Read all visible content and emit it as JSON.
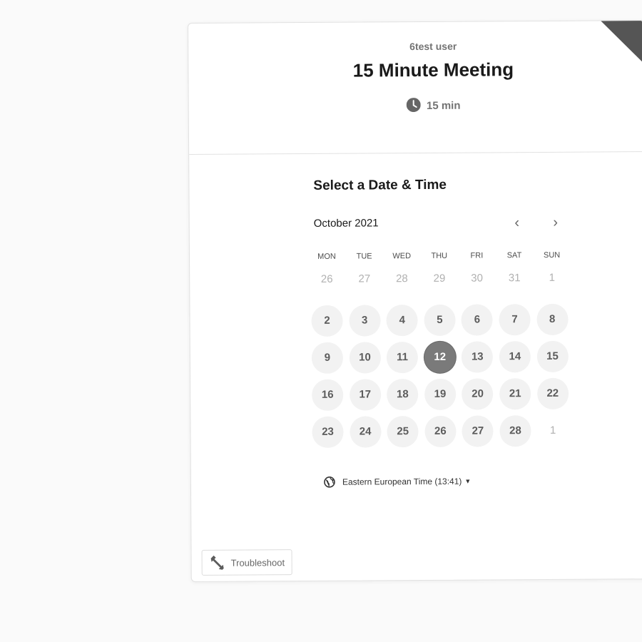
{
  "event": {
    "owner": "6test user",
    "title": "15 Minute Meeting",
    "duration": "15 min",
    "duration_icon": "clock-icon"
  },
  "calendar": {
    "heading": "Select a Date & Time",
    "month": "October 2021",
    "prev_label": "‹",
    "next_label": "›",
    "weekdays": [
      "MON",
      "TUE",
      "WED",
      "THU",
      "FRI",
      "SAT",
      "SUN"
    ],
    "weeks": [
      [
        {
          "d": "26",
          "s": "muted"
        },
        {
          "d": "27",
          "s": "muted"
        },
        {
          "d": "28",
          "s": "muted"
        },
        {
          "d": "29",
          "s": "muted"
        },
        {
          "d": "30",
          "s": "muted"
        },
        {
          "d": "31",
          "s": "muted"
        },
        {
          "d": "1",
          "s": "muted"
        }
      ],
      [
        {
          "d": "2",
          "s": "avail"
        },
        {
          "d": "3",
          "s": "avail"
        },
        {
          "d": "4",
          "s": "avail"
        },
        {
          "d": "5",
          "s": "avail"
        },
        {
          "d": "6",
          "s": "avail"
        },
        {
          "d": "7",
          "s": "avail"
        },
        {
          "d": "8",
          "s": "avail"
        }
      ],
      [
        {
          "d": "9",
          "s": "avail"
        },
        {
          "d": "10",
          "s": "avail"
        },
        {
          "d": "11",
          "s": "avail"
        },
        {
          "d": "12",
          "s": "selected"
        },
        {
          "d": "13",
          "s": "avail"
        },
        {
          "d": "14",
          "s": "avail"
        },
        {
          "d": "15",
          "s": "avail"
        }
      ],
      [
        {
          "d": "16",
          "s": "avail"
        },
        {
          "d": "17",
          "s": "avail"
        },
        {
          "d": "18",
          "s": "avail"
        },
        {
          "d": "19",
          "s": "avail"
        },
        {
          "d": "20",
          "s": "avail"
        },
        {
          "d": "21",
          "s": "avail"
        },
        {
          "d": "22",
          "s": "avail"
        }
      ],
      [
        {
          "d": "23",
          "s": "avail"
        },
        {
          "d": "24",
          "s": "avail"
        },
        {
          "d": "25",
          "s": "avail"
        },
        {
          "d": "26",
          "s": "avail"
        },
        {
          "d": "27",
          "s": "avail"
        },
        {
          "d": "28",
          "s": "avail"
        },
        {
          "d": "1",
          "s": "muted"
        }
      ]
    ],
    "selected_date": "12"
  },
  "timezone": {
    "label": "Eastern European Time (13:41)",
    "icon": "globe-icon"
  },
  "troubleshoot": {
    "label": "Troubleshoot",
    "icon": "wrench-icon"
  },
  "colors": {
    "selected_day": "#7a7a7a",
    "available_day_bg": "#f2f2f2",
    "corner_badge": "#555555"
  }
}
